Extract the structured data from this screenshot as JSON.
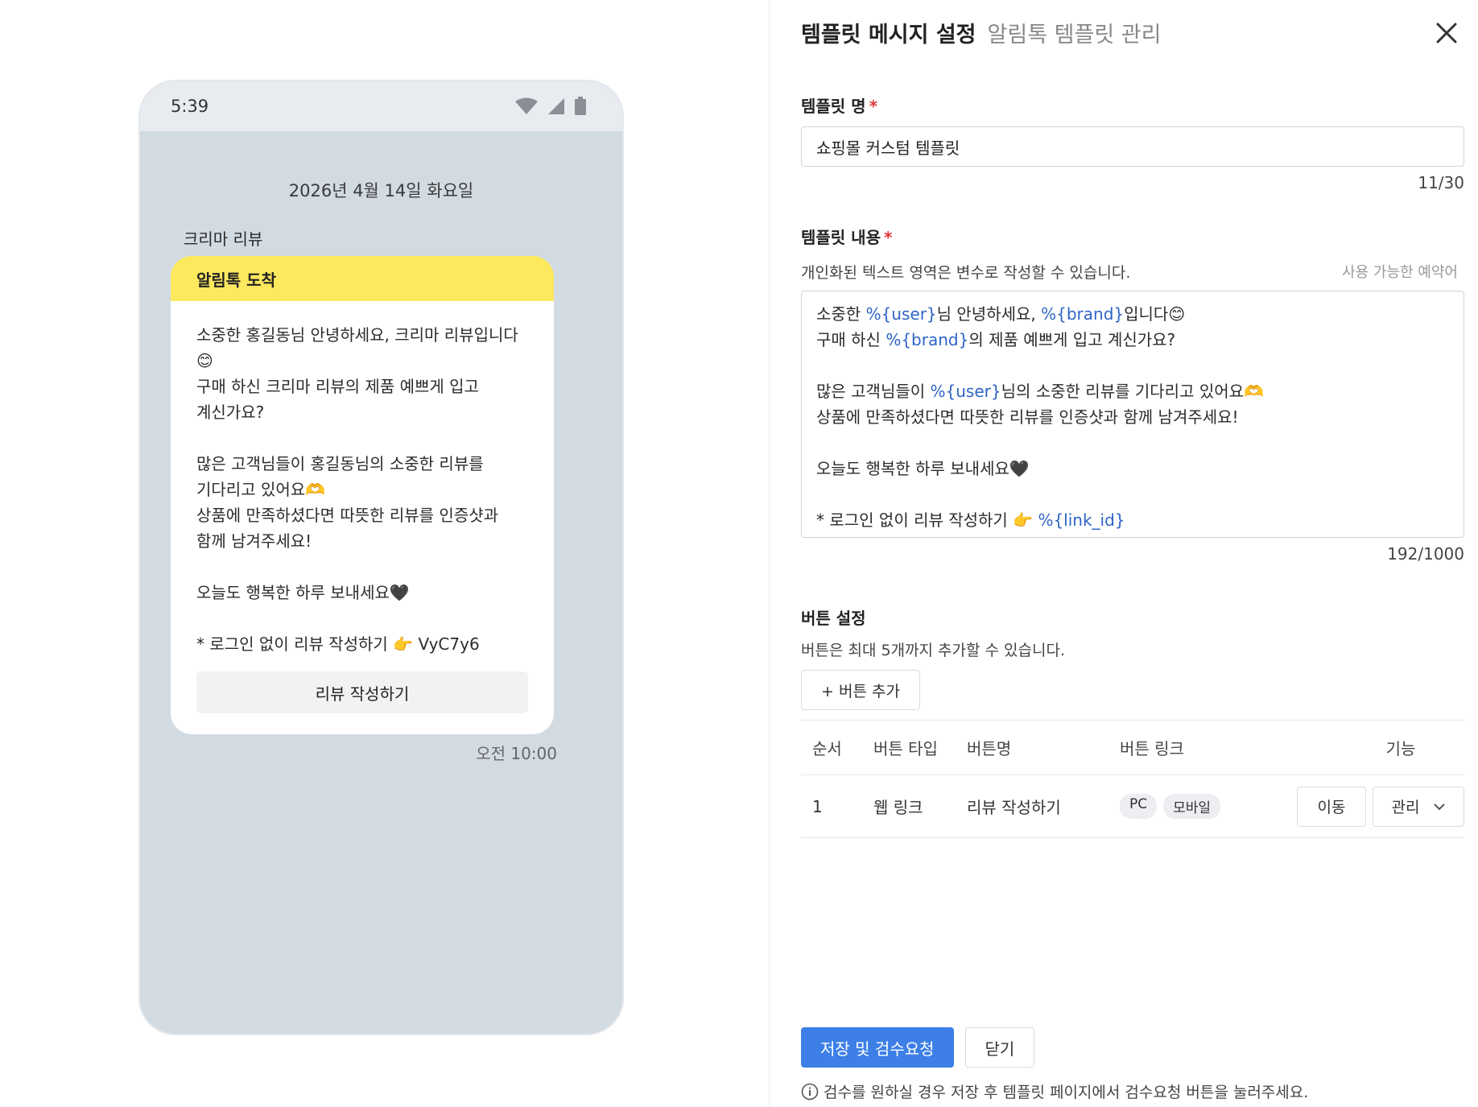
{
  "preview": {
    "status_time": "5:39",
    "date": "2026년 4월 14일 화요일",
    "sender": "크리마 리뷰",
    "bubble_header": "알림톡 도착",
    "bubble_body": "소중한 홍길동님 안녕하세요, 크리마 리뷰입니다😊\n구매 하신 크리마 리뷰의 제품 예쁘게 입고 계신가요?\n\n많은 고객님들이 홍길동님의 소중한 리뷰를 기다리고 있어요🫶\n상품에 만족하셨다면 따뜻한 리뷰를 인증샷과 함께 남겨주세요!\n\n오늘도 행복한 하루 보내세요🖤\n\n* 로그인 없이 리뷰 작성하기 👉 VyC7y6",
    "bubble_button": "리뷰 작성하기",
    "message_time": "오전 10:00"
  },
  "panel": {
    "title": "템플릿 메시지 설정",
    "subtitle": "알림톡 템플릿 관리",
    "template_name": {
      "label": "템플릿 명",
      "required_mark": "*",
      "value": "쇼핑몰 커스텀 템플릿",
      "counter": "11/30"
    },
    "template_content": {
      "label": "템플릿 내용",
      "required_mark": "*",
      "description": "개인화된 텍스트 영역은 변수로 작성할 수 있습니다.",
      "reserved_words_link": "사용 가능한 예약어",
      "counter": "192/1000",
      "lines": [
        [
          {
            "t": "소중한 "
          },
          {
            "t": "%{user}",
            "var": true
          },
          {
            "t": "님 안녕하세요, "
          },
          {
            "t": "%{brand}",
            "var": true
          },
          {
            "t": "입니다😊"
          }
        ],
        [
          {
            "t": "구매 하신 "
          },
          {
            "t": "%{brand}",
            "var": true
          },
          {
            "t": "의 제품 예쁘게 입고 계신가요?"
          }
        ],
        [],
        [
          {
            "t": "많은 고객님들이 "
          },
          {
            "t": "%{user}",
            "var": true
          },
          {
            "t": "님의 소중한 리뷰를 기다리고 있어요🫶"
          }
        ],
        [
          {
            "t": "상품에 만족하셨다면 따뜻한 리뷰를 인증샷과 함께 남겨주세요!"
          }
        ],
        [],
        [
          {
            "t": "오늘도 행복한 하루 보내세요🖤"
          }
        ],
        [],
        [
          {
            "t": "* 로그인 없이 리뷰 작성하기 👉 "
          },
          {
            "t": "%{link_id}",
            "var": true
          }
        ]
      ]
    },
    "button_settings": {
      "label": "버튼 설정",
      "description": "버튼은 최대 5개까지 추가할 수 있습니다.",
      "add_button": "+ 버튼 추가",
      "columns": [
        "순서",
        "버튼 타입",
        "버튼명",
        "버튼 링크",
        "기능"
      ],
      "rows": [
        {
          "order": "1",
          "type": "웹 링크",
          "name": "리뷰 작성하기",
          "links": [
            "PC",
            "모바일"
          ],
          "move": "이동",
          "manage": "관리"
        }
      ]
    },
    "footer": {
      "save_button": "저장 및 검수요청",
      "close_button": "닫기",
      "note": "검수를 원하실 경우 저장 후 템플릿 페이지에서 검수요청 버튼을 눌러주세요."
    }
  },
  "colors": {
    "accent": "#3d7fe6",
    "bubble_header": "#fde95e",
    "chat_bg": "#d2dae2",
    "variable": "#2e64c6",
    "required": "#e5333b"
  }
}
